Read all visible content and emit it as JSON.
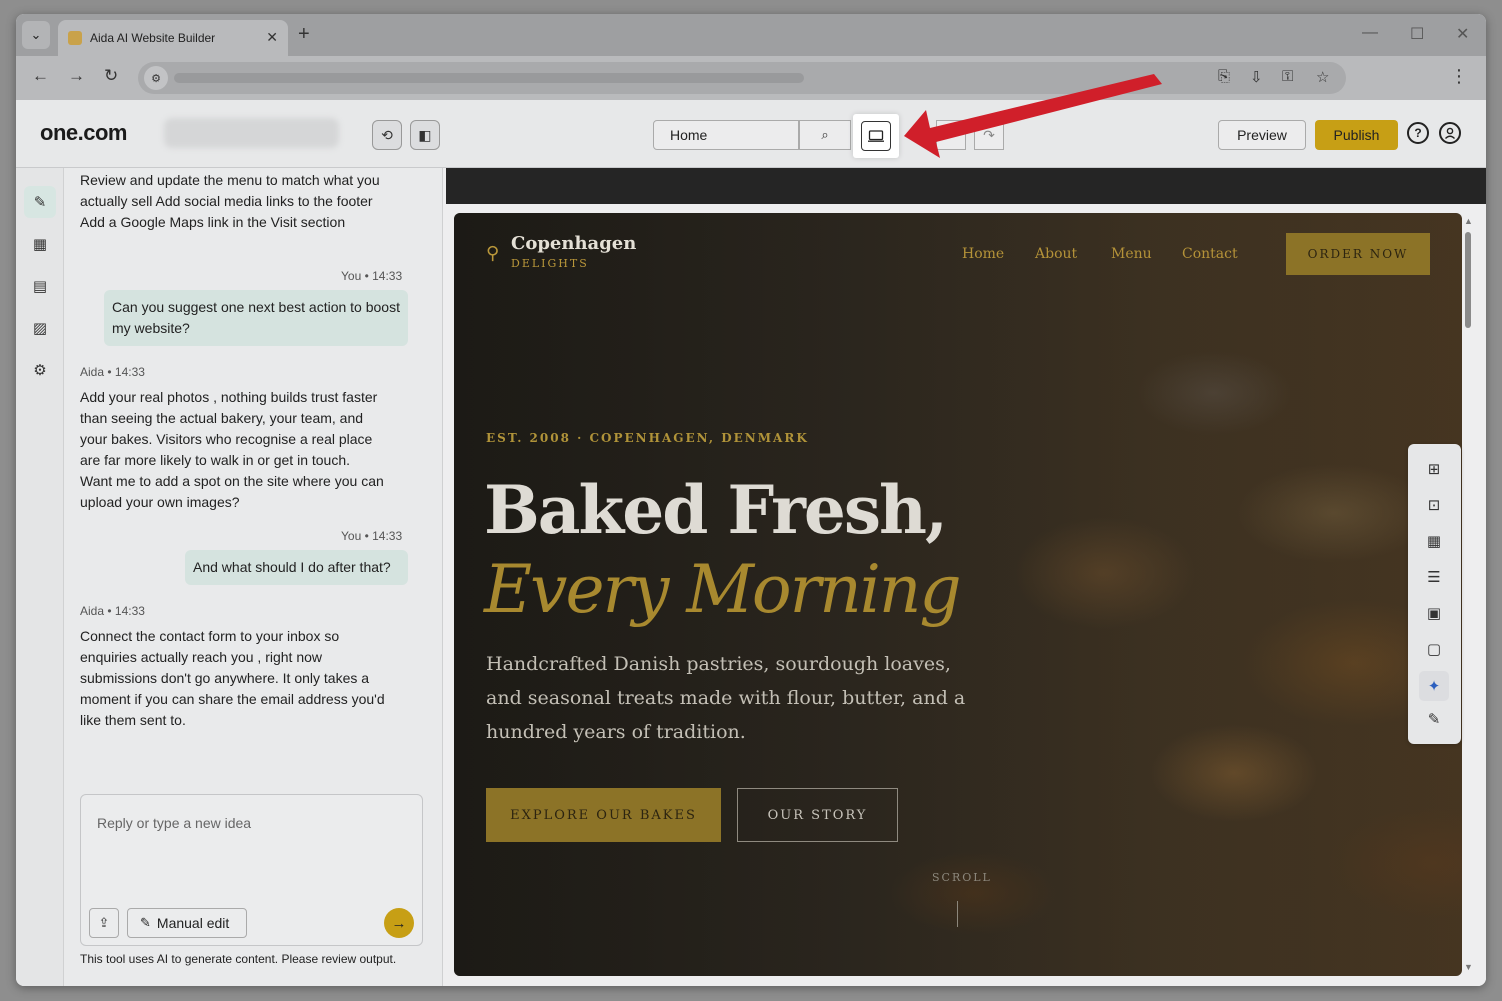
{
  "browser": {
    "tab_title": "Aida AI Website Builder",
    "tab_close": "✕",
    "new_tab": "+",
    "dropdown": "⌄",
    "min": "—",
    "max": "☐",
    "close": "✕",
    "back": "←",
    "forward": "→",
    "reload": "↻",
    "site_settings": "⚙",
    "translate": "⎘",
    "install": "⇩",
    "passwords": "⚿",
    "bookmark": "☆",
    "menu": "⋮"
  },
  "app": {
    "logo": "one.com",
    "history_icon": "⟲",
    "panel_icon": "◧",
    "page_select": "Home",
    "page_search_icon": "⌕",
    "undo_icon": "↶",
    "redo_icon": "↷",
    "preview_label": "Preview",
    "publish_label": "Publish",
    "help_icon": "?",
    "account_icon": "◉"
  },
  "rail": {
    "items": [
      {
        "name": "ai-edit",
        "icon": "✎"
      },
      {
        "name": "store",
        "icon": "▦"
      },
      {
        "name": "calendar",
        "icon": "▤"
      },
      {
        "name": "analytics",
        "icon": "▨"
      },
      {
        "name": "settings",
        "icon": "⚙"
      }
    ]
  },
  "chat": {
    "messages": [
      {
        "type": "ai",
        "text": "Review and update the menu to match what you actually sell Add social media links to the footer Add a Google Maps link in the Visit section"
      },
      {
        "type": "user",
        "author": "You",
        "time": "14:33",
        "text": "Can you suggest one next best action to boost my website?"
      },
      {
        "type": "ai",
        "author": "Aida",
        "time": "14:33",
        "text": "Add your real photos , nothing builds trust faster than seeing the actual bakery, your team, and your bakes. Visitors who recognise a real place are far more likely to walk in or get in touch. Want me to add a spot on the site where you can upload your own images?"
      },
      {
        "type": "user",
        "author": "You",
        "time": "14:33",
        "text": "And what should I do after that?"
      },
      {
        "type": "ai",
        "author": "Aida",
        "time": "14:33",
        "text": "Connect the contact form to your inbox so enquiries actually reach you , right now submissions don't go anywhere. It only takes a moment if you can share the email address you'd like them sent to."
      }
    ],
    "placeholder": "Reply or type a new idea",
    "upload_icon": "⇪",
    "manual_edit_label": "Manual edit",
    "pen_icon": "✎",
    "send_icon": "→",
    "disclaimer": "This tool uses AI to generate content. Please review output."
  },
  "site": {
    "logo_icon": "⚲",
    "name": "Copenhagen",
    "tagline": "DELIGHTS",
    "nav": [
      "Home",
      "About",
      "Menu",
      "Contact"
    ],
    "order_label": "ORDER NOW",
    "est": "EST. 2008 · COPENHAGEN, DENMARK",
    "headline_1": "Baked Fresh,",
    "headline_2": "Every Morning",
    "subtitle": "Handcrafted Danish pastries, sourdough loaves, and seasonal treats made with flour, butter, and a hundred years of tradition.",
    "explore_label": "EXPLORE OUR BAKES",
    "story_label": "OUR STORY",
    "scroll_label": "SCROLL"
  },
  "widgets": [
    {
      "name": "layout",
      "icon": "⊞"
    },
    {
      "name": "briefcase",
      "icon": "⊡"
    },
    {
      "name": "store",
      "icon": "▦"
    },
    {
      "name": "text-block",
      "icon": "☰"
    },
    {
      "name": "gallery",
      "icon": "▣"
    },
    {
      "name": "contact-card",
      "icon": "▢"
    },
    {
      "name": "ai-sparkle",
      "icon": "✦"
    },
    {
      "name": "pen",
      "icon": "✎"
    }
  ],
  "colors": {
    "accent": "#c79f15",
    "site_gold": "#a8892f",
    "annotation_arrow": "#d01f2a"
  }
}
